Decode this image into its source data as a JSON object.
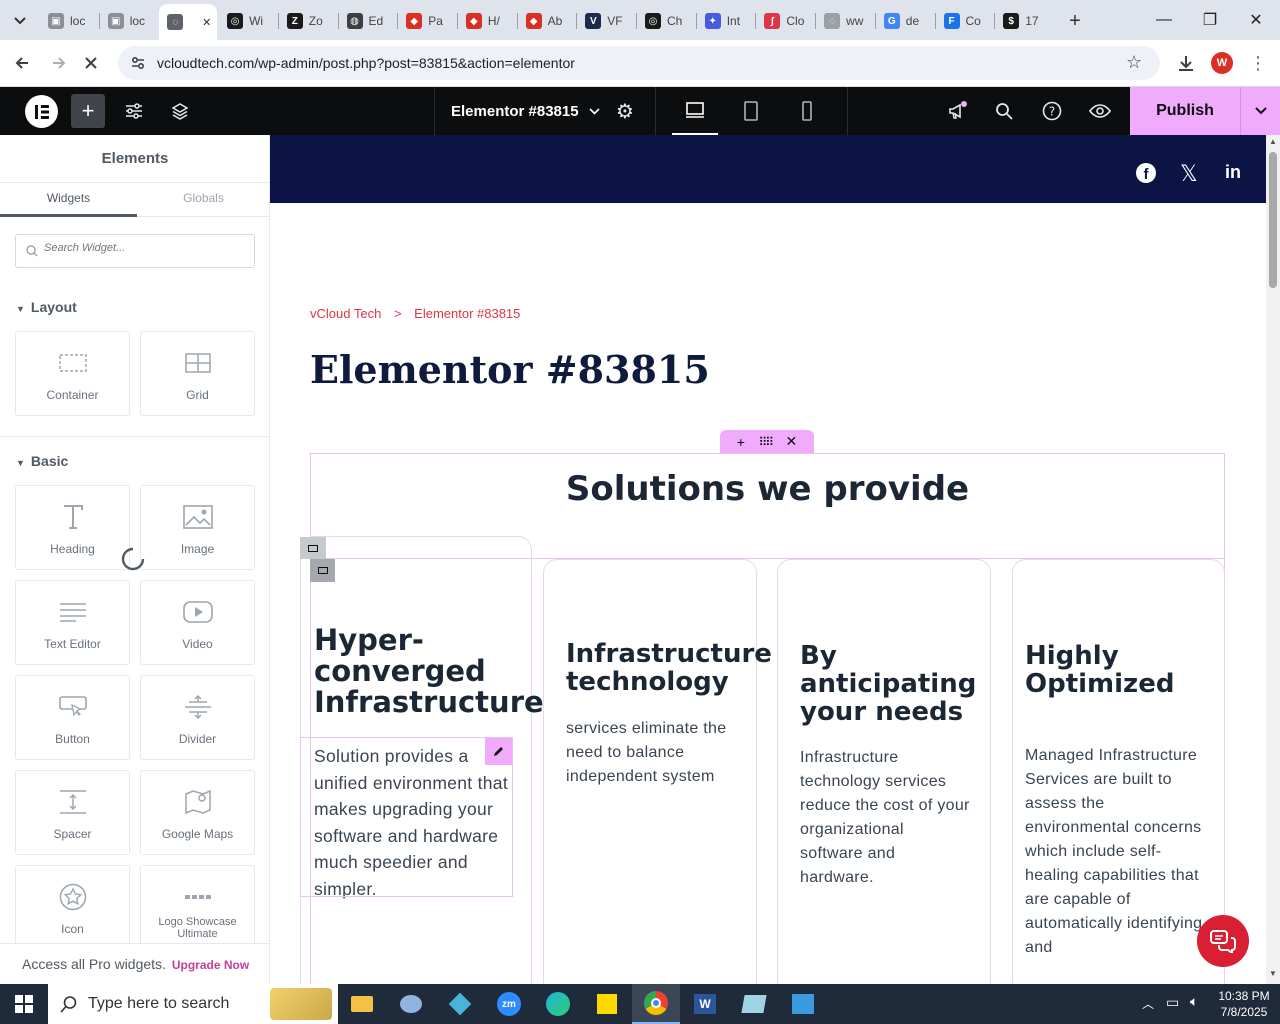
{
  "browser": {
    "tabs": [
      {
        "label": "loc",
        "icon": "page-icon",
        "color": "#8a8f98",
        "glyph": "▣"
      },
      {
        "label": "loc",
        "icon": "page-icon",
        "color": "#8a8f98",
        "glyph": "▣"
      },
      {
        "label": "",
        "icon": "loading-icon",
        "color": "#5f6368",
        "glyph": "◌",
        "active": true
      },
      {
        "label": "Wi",
        "icon": "chatgpt-icon",
        "color": "#1a1a1a",
        "glyph": "◎"
      },
      {
        "label": "Zo",
        "icon": "zotero-icon",
        "color": "#1a1a1a",
        "glyph": "Z"
      },
      {
        "label": "Ed",
        "icon": "globe-icon",
        "color": "#3c4043",
        "glyph": "◍"
      },
      {
        "label": "Pa",
        "icon": "pdf-icon",
        "color": "#d93025",
        "glyph": "◆"
      },
      {
        "label": "H/",
        "icon": "pdf-icon",
        "color": "#d93025",
        "glyph": "◆"
      },
      {
        "label": "Ab",
        "icon": "pdf-icon",
        "color": "#d93025",
        "glyph": "◆"
      },
      {
        "label": "VF",
        "icon": "v-icon",
        "color": "#1e2a4a",
        "glyph": "V"
      },
      {
        "label": "Ch",
        "icon": "chatgpt-icon",
        "color": "#1a1a1a",
        "glyph": "◎"
      },
      {
        "label": "Int",
        "icon": "copilot-icon",
        "color": "#4a5ae0",
        "glyph": "✦"
      },
      {
        "label": "Clo",
        "icon": "signature-icon",
        "color": "#e0364a",
        "glyph": "∫"
      },
      {
        "label": "ww",
        "icon": "loading-icon",
        "color": "#9aa0a6",
        "glyph": "◌"
      },
      {
        "label": "de",
        "icon": "google-icon",
        "color": "#4285f4",
        "glyph": "G"
      },
      {
        "label": "Co",
        "icon": "forms-icon",
        "color": "#1a73e8",
        "glyph": "F"
      },
      {
        "label": "17",
        "icon": "dollar-icon",
        "color": "#1a1a1a",
        "glyph": "$"
      }
    ],
    "url": "vcloudtech.com/wp-admin/post.php?post=83815&action=elementor",
    "profile_initial": "W"
  },
  "elementor": {
    "document_title": "Elementor #83815",
    "publish_label": "Publish",
    "accent": "#f0abfc"
  },
  "panel": {
    "title": "Elements",
    "tab_widgets": "Widgets",
    "tab_globals": "Globals",
    "search_placeholder": "Search Widget...",
    "section_layout": "Layout",
    "section_basic": "Basic",
    "layout_widgets": [
      {
        "label": "Container",
        "icon": "container-icon"
      },
      {
        "label": "Grid",
        "icon": "grid-icon"
      }
    ],
    "basic_widgets": [
      {
        "label": "Heading",
        "icon": "heading-icon"
      },
      {
        "label": "Image",
        "icon": "image-icon"
      },
      {
        "label": "Text Editor",
        "icon": "text-editor-icon"
      },
      {
        "label": "Video",
        "icon": "video-icon"
      },
      {
        "label": "Button",
        "icon": "button-icon"
      },
      {
        "label": "Divider",
        "icon": "divider-icon"
      },
      {
        "label": "Spacer",
        "icon": "spacer-icon"
      },
      {
        "label": "Google Maps",
        "icon": "map-icon"
      },
      {
        "label": "Icon",
        "icon": "star-icon"
      },
      {
        "label": "Logo Showcase Ultimate",
        "icon": "logo-showcase-icon"
      }
    ],
    "promo_text": "Access all Pro widgets.",
    "promo_link": "Upgrade Now"
  },
  "page": {
    "header_bg": "#0c1445",
    "breadcrumb_home": "vCloud Tech",
    "breadcrumb_sep": ">",
    "breadcrumb_current": "Elementor #83815",
    "title": "Elementor #83815",
    "section_heading": "Solutions we provide",
    "cards": [
      {
        "title": "Hyper-\nconverged\nInfrastructure",
        "desc": "Solution provides a unified environment that makes upgrading your software and hardware much speedier and simpler."
      },
      {
        "title": "Infrastructure\ntechnology",
        "desc": "services eliminate the need to balance independent system"
      },
      {
        "title": "By\nanticipating\nyour needs",
        "desc": "Infrastructure technology services reduce the cost of your organizational software and hardware."
      },
      {
        "title": "Highly\nOptimized",
        "desc": "Managed Infrastructure Services are built to assess the environmental concerns which include self-healing capabilities that are capable of automatically identifying and"
      }
    ]
  },
  "taskbar": {
    "search_placeholder": "Type here to search",
    "time": "10:38 PM",
    "date": "7/8/2025"
  }
}
